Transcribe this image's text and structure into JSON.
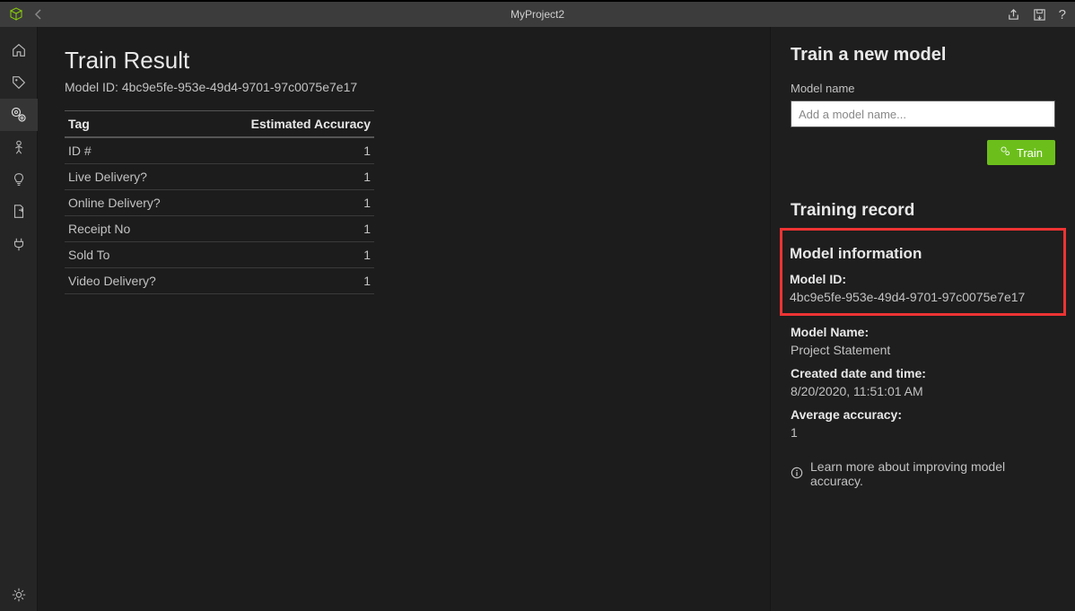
{
  "titlebar": {
    "title": "MyProject2"
  },
  "main": {
    "heading": "Train Result",
    "model_id_prefix": "Model ID: ",
    "model_id": "4bc9e5fe-953e-49d4-9701-97c0075e7e17",
    "table": {
      "col_tag": "Tag",
      "col_acc": "Estimated Accuracy",
      "rows": [
        {
          "tag": "ID #",
          "acc": "1"
        },
        {
          "tag": "Live Delivery?",
          "acc": "1"
        },
        {
          "tag": "Online Delivery?",
          "acc": "1"
        },
        {
          "tag": "Receipt No",
          "acc": "1"
        },
        {
          "tag": "Sold To",
          "acc": "1"
        },
        {
          "tag": "Video Delivery?",
          "acc": "1"
        }
      ]
    }
  },
  "right": {
    "train_heading": "Train a new model",
    "model_name_label": "Model name",
    "model_name_placeholder": "Add a model name...",
    "train_button": "Train",
    "record_heading": "Training record",
    "model_info_heading": "Model information",
    "model_id_label": "Model ID:",
    "model_id_value": "4bc9e5fe-953e-49d4-9701-97c0075e7e17",
    "model_name_label2": "Model Name:",
    "model_name_value": "Project Statement",
    "created_label": "Created date and time:",
    "created_value": "8/20/2020, 11:51:01 AM",
    "avg_acc_label": "Average accuracy:",
    "avg_acc_value": "1",
    "learn_more": "Learn more about improving model accuracy."
  }
}
